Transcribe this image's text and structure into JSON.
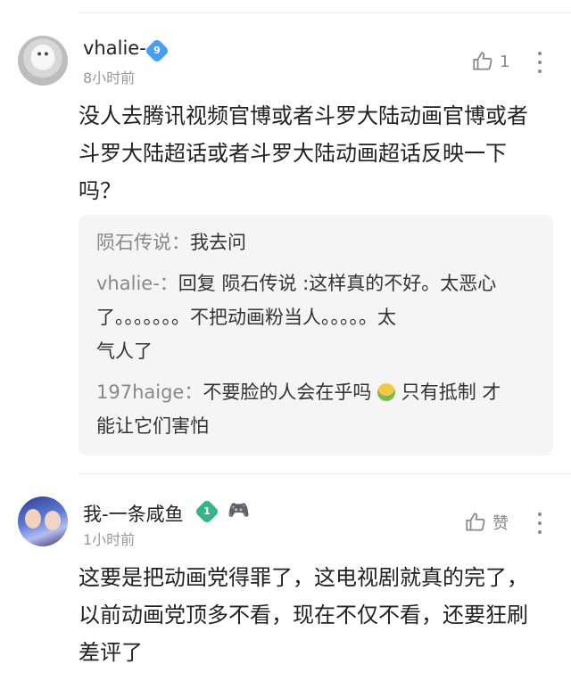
{
  "comments": [
    {
      "username": "vhalie-",
      "badge_level": "9",
      "time": "8小时前",
      "like_count": "1",
      "body_lines": [
        "没人去腾讯视频官博或者斗罗大陆动画官博或者",
        "斗罗大陆超话或者斗罗大陆动画超话反映一下",
        "吗？"
      ],
      "replies": [
        {
          "name": "陨石传说：",
          "lines": [
            "我去问"
          ]
        },
        {
          "name": "vhalie-：",
          "lines": [
            "回复 陨石传说 :这样真的不好。太恶心",
            "了。。。。。。。不把动画粉当人。。。。。太",
            "气人了"
          ]
        },
        {
          "name": "197haige：",
          "lines": [
            "不要脸的人会在乎吗",
            " 只有抵制 才",
            "能让它们害怕"
          ]
        }
      ]
    },
    {
      "username": "我-一条咸鱼",
      "badge_level": "1",
      "time": "1小时前",
      "like_label": "赞",
      "body_lines": [
        "这要是把动画党得罪了，这电视剧就真的完了，",
        "以前动画党顶多不看，现在不仅不看，还要狂刷",
        "差评了"
      ]
    }
  ],
  "icons": {
    "thumb": "thumbs-up-icon",
    "more": "more-vertical-icon",
    "game": "gamepad-icon",
    "emoji": "nauseated-face-emoji"
  },
  "colors": {
    "badge_blue": "#4a9ff5",
    "badge_green": "#37b58a",
    "reply_bg": "#f5f5f5"
  }
}
